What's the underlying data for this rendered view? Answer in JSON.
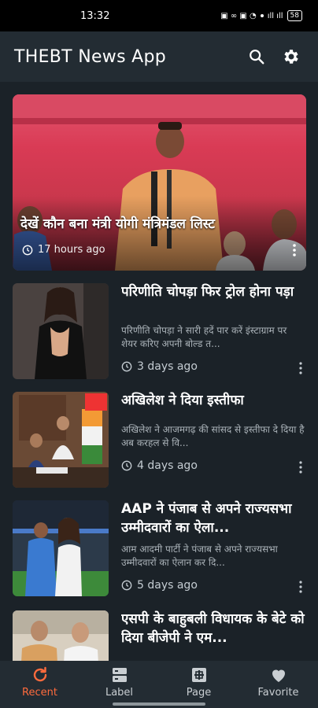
{
  "status_bar": {
    "time": "13:32",
    "battery": "58"
  },
  "app_bar": {
    "title": "THEBT News App"
  },
  "featured": {
    "title": "देखें कौन बना मंत्री योगी मंत्रिमंडल लिस्ट",
    "time": "17 hours ago"
  },
  "articles": [
    {
      "title": "परिणीति चोपड़ा फिर ट्रोल होना पड़ा",
      "desc": "परिणीति चोपड़ा ने सारी हदें पार करें इंस्टाग्राम पर शेयर करिए अपनी बोल्ड त...",
      "time": "3 days ago"
    },
    {
      "title": "अखिलेश ने दिया इस्तीफा",
      "desc": "अखिलेश ने आजमगढ़ की सांसद से इस्तीफा दे दिया है अब करहल से वि...",
      "time": "4 days ago"
    },
    {
      "title": "AAP ने पंजाब से अपने राज्यसभा उम्मीदवारों का ऐला...",
      "desc": "आम आदमी पार्टी ने पंजाब से अपने राज्यसभा उम्मीदवारों का ऐलान कर दि...",
      "time": "5 days ago"
    },
    {
      "title": "एसपी के बाहुबली विधायक के बेटे को दिया बीजेपी ने एम...",
      "desc": "",
      "time": ""
    }
  ],
  "bottom_nav": [
    {
      "label": "Recent",
      "icon": "refresh-icon",
      "active": true
    },
    {
      "label": "Label",
      "icon": "label-icon",
      "active": false
    },
    {
      "label": "Page",
      "icon": "page-icon",
      "active": false
    },
    {
      "label": "Favorite",
      "icon": "heart-icon",
      "active": false
    }
  ],
  "colors": {
    "accent": "#ff6b3d",
    "background": "#1b2228",
    "bar": "#232c33"
  }
}
